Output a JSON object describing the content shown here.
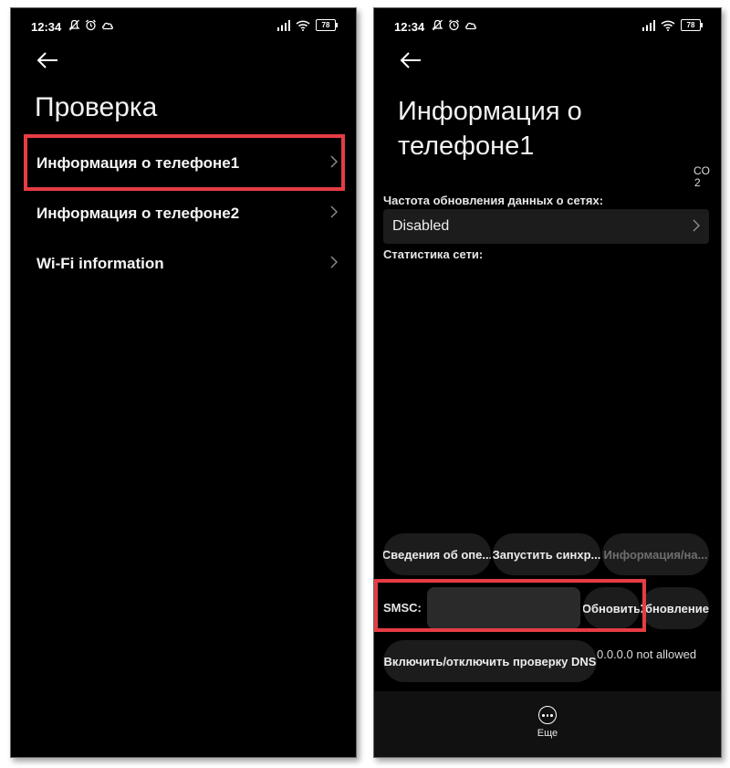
{
  "status_bar": {
    "time": "12:34",
    "battery": "78"
  },
  "left_screen": {
    "title": "Проверка",
    "items": [
      {
        "label": "Информация о телефоне1"
      },
      {
        "label": "Информация о телефоне2"
      },
      {
        "label": "Wi-Fi information"
      }
    ]
  },
  "right_screen": {
    "title_line1": "Информация о",
    "title_line2": "телефоне1",
    "corner_text_1": "CO",
    "corner_text_2": "2",
    "refresh_label": "Частота обновления данных о сетях:",
    "refresh_value": "Disabled",
    "network_stats_label": "Статистика сети:",
    "buttons": {
      "operator_info": "Сведения об опе...",
      "run_sync": "Запустить синхр...",
      "info_na": "Информация/на...",
      "smsc_label": "SMSC:",
      "smsc_value": "",
      "refresh": "Обновить",
      "update": "Обновление",
      "dns_toggle": "Включить/отключить проверку DNS",
      "dns_status": "0.0.0.0 not allowed"
    },
    "bottom": {
      "more_label": "Еще"
    }
  },
  "colors": {
    "highlight": "#e63c44",
    "background": "#000000",
    "surface": "#1c1c1c"
  }
}
